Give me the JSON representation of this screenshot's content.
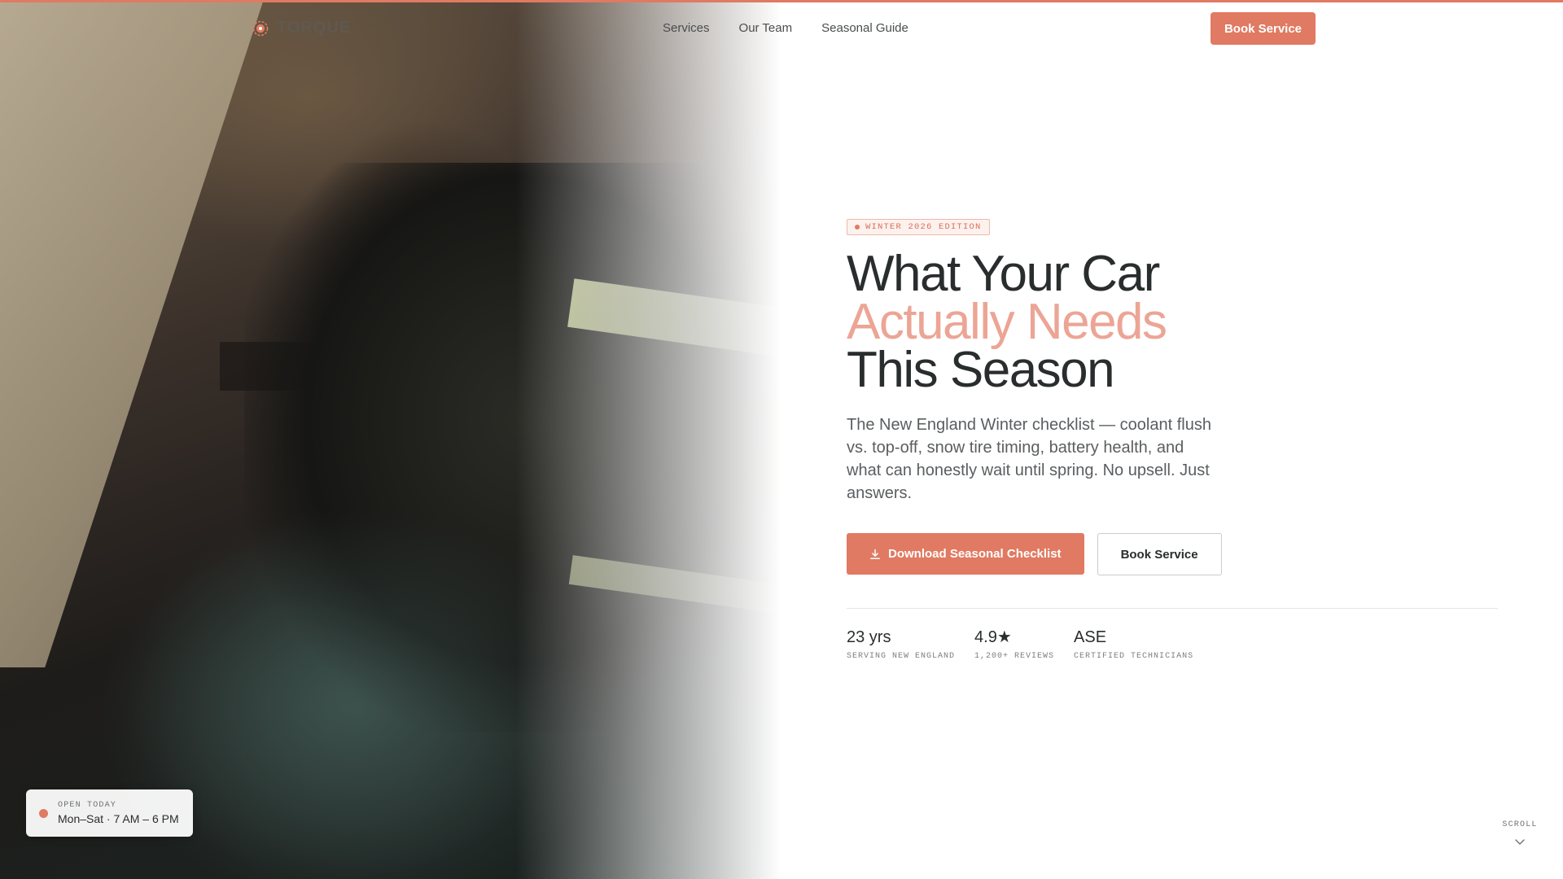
{
  "brand": {
    "name": "TORQUE",
    "accent_color": "#e07a62",
    "logo_icon": "gear-shield-icon"
  },
  "nav": {
    "links": [
      {
        "label": "Services"
      },
      {
        "label": "Our Team"
      },
      {
        "label": "Seasonal Guide"
      }
    ],
    "cta_label": "Book Service"
  },
  "hero": {
    "badge": "WINTER 2026 EDITION",
    "headline_line1": "What Your Car",
    "headline_line2": "Actually Needs",
    "headline_line3": "This Season",
    "lede": "The New England Winter checklist — coolant flush vs. top-off, snow tire timing, battery health, and what can honestly wait until spring. No upsell. Just answers.",
    "primary_cta": {
      "label": "Download Seasonal Checklist",
      "icon": "download-icon"
    },
    "secondary_cta": {
      "label": "Book Service"
    },
    "image_alt": "mechanic working under open car hood"
  },
  "stats": [
    {
      "value": "23 yrs",
      "label": "SERVING NEW ENGLAND"
    },
    {
      "value": "4.9★",
      "label": "1,200+ REVIEWS"
    },
    {
      "value": "ASE",
      "label": "CERTIFIED TECHNICIANS"
    }
  ],
  "hours": {
    "label": "OPEN TODAY",
    "text": "Mon–Sat · 7 AM – 6 PM"
  },
  "scroll": {
    "label": "SCROLL",
    "icon": "chevron-down-icon"
  }
}
